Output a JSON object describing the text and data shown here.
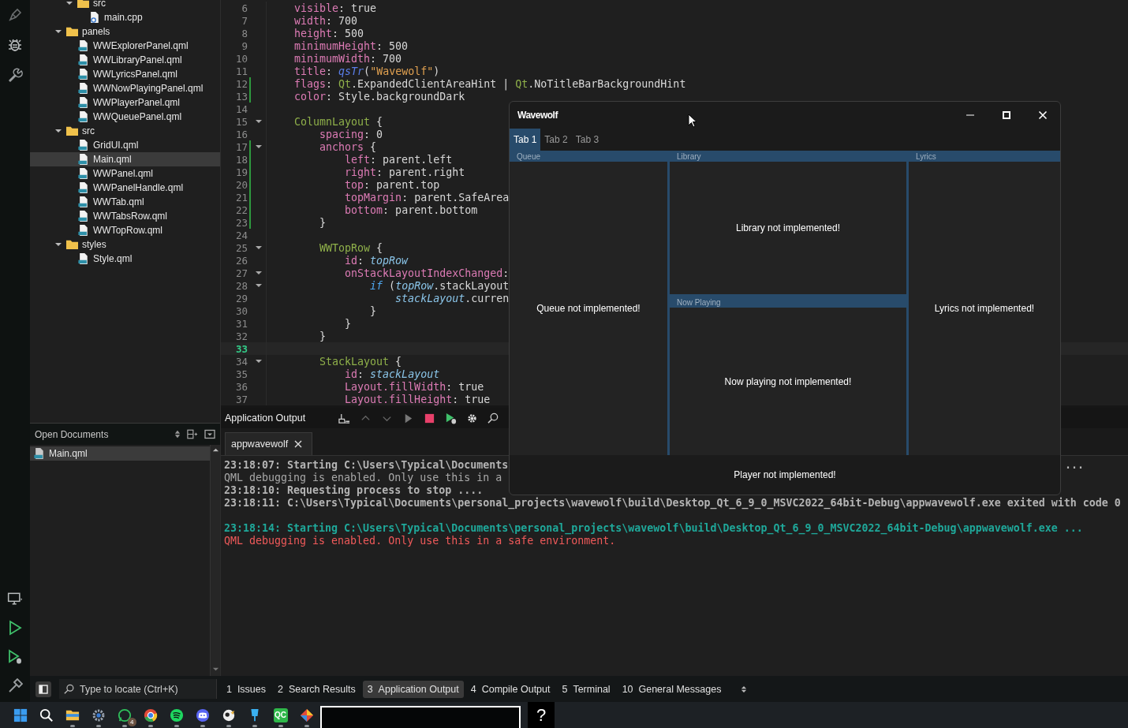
{
  "tree_top": [
    {
      "label": "src",
      "kind": "folder",
      "expanded": true,
      "selected": false,
      "children": [
        {
          "label": "main.cpp",
          "kind": "cpp",
          "selected": false
        }
      ]
    }
  ],
  "tree": [
    {
      "label": "panels",
      "kind": "folder",
      "expanded": true,
      "selected": false,
      "children": [
        {
          "label": "WWExplorerPanel.qml",
          "kind": "qml",
          "selected": false
        },
        {
          "label": "WWLibraryPanel.qml",
          "kind": "qml",
          "selected": false
        },
        {
          "label": "WWLyricsPanel.qml",
          "kind": "qml",
          "selected": false
        },
        {
          "label": "WWNowPlayingPanel.qml",
          "kind": "qml",
          "selected": false
        },
        {
          "label": "WWPlayerPanel.qml",
          "kind": "qml",
          "selected": false
        },
        {
          "label": "WWQueuePanel.qml",
          "kind": "qml",
          "selected": false
        }
      ]
    },
    {
      "label": "src",
      "kind": "folder",
      "expanded": true,
      "selected": false,
      "children": [
        {
          "label": "GridUI.qml",
          "kind": "qml",
          "selected": false
        },
        {
          "label": "Main.qml",
          "kind": "qml",
          "selected": true
        },
        {
          "label": "WWPanel.qml",
          "kind": "qml",
          "selected": false
        },
        {
          "label": "WWPanelHandle.qml",
          "kind": "qml",
          "selected": false
        },
        {
          "label": "WWTab.qml",
          "kind": "qml",
          "selected": false
        },
        {
          "label": "WWTabsRow.qml",
          "kind": "qml",
          "selected": false
        },
        {
          "label": "WWTopRow.qml",
          "kind": "qml",
          "selected": false
        }
      ]
    },
    {
      "label": "styles",
      "kind": "folder",
      "expanded": true,
      "selected": false,
      "children": [
        {
          "label": "Style.qml",
          "kind": "qml",
          "selected": false
        }
      ]
    }
  ],
  "open_documents": {
    "title": "Open Documents",
    "items": [
      {
        "label": "Main.qml",
        "selected": true
      }
    ]
  },
  "editor": {
    "lines": [
      {
        "n": "6",
        "changed": false,
        "foldable": false,
        "current": false,
        "tokens": [
          {
            "kind": "p",
            "t": "    visible"
          },
          {
            "kind": "t",
            "t": ": true"
          }
        ]
      },
      {
        "n": "7",
        "changed": false,
        "foldable": false,
        "current": false,
        "tokens": [
          {
            "kind": "p",
            "t": "    width"
          },
          {
            "kind": "t",
            "t": ": 700"
          }
        ]
      },
      {
        "n": "8",
        "changed": false,
        "foldable": false,
        "current": false,
        "tokens": [
          {
            "kind": "p",
            "t": "    height"
          },
          {
            "kind": "t",
            "t": ": 500"
          }
        ]
      },
      {
        "n": "9",
        "changed": false,
        "foldable": false,
        "current": false,
        "tokens": [
          {
            "kind": "p",
            "t": "    minimumHeight"
          },
          {
            "kind": "t",
            "t": ": 500"
          }
        ]
      },
      {
        "n": "10",
        "changed": false,
        "foldable": false,
        "current": false,
        "tokens": [
          {
            "kind": "p",
            "t": "    minimumWidth"
          },
          {
            "kind": "t",
            "t": ": 700"
          }
        ]
      },
      {
        "n": "11",
        "changed": false,
        "foldable": false,
        "current": false,
        "tokens": [
          {
            "kind": "p",
            "t": "    title"
          },
          {
            "kind": "t",
            "t": ": "
          },
          {
            "kind": "fn",
            "t": "qsTr"
          },
          {
            "kind": "t",
            "t": "("
          },
          {
            "kind": "s",
            "t": "\"Wavewolf\""
          },
          {
            "kind": "t",
            "t": ")"
          }
        ]
      },
      {
        "n": "12",
        "changed": true,
        "foldable": false,
        "current": false,
        "tokens": [
          {
            "kind": "p",
            "t": "    flags"
          },
          {
            "kind": "t",
            "t": ": "
          },
          {
            "kind": "ty",
            "t": "Qt"
          },
          {
            "kind": "t",
            "t": ".ExpandedClientAreaHint | "
          },
          {
            "kind": "ty",
            "t": "Qt"
          },
          {
            "kind": "t",
            "t": ".NoTitleBarBackgroundHint"
          }
        ]
      },
      {
        "n": "13",
        "changed": true,
        "foldable": false,
        "current": false,
        "tokens": [
          {
            "kind": "p",
            "t": "    color"
          },
          {
            "kind": "t",
            "t": ": Style.backgroundDark"
          }
        ]
      },
      {
        "n": "14",
        "changed": false,
        "foldable": false,
        "current": false
      },
      {
        "n": "15",
        "changed": false,
        "foldable": true,
        "current": false,
        "tokens": [
          {
            "kind": "ty",
            "t": "    ColumnLayout"
          },
          {
            "kind": "t",
            "t": " {"
          }
        ]
      },
      {
        "n": "16",
        "changed": false,
        "foldable": false,
        "current": false,
        "tokens": [
          {
            "kind": "p",
            "t": "        spacing"
          },
          {
            "kind": "t",
            "t": ": 0"
          }
        ]
      },
      {
        "n": "17",
        "changed": true,
        "foldable": true,
        "current": false,
        "tokens": [
          {
            "kind": "p",
            "t": "        anchors"
          },
          {
            "kind": "t",
            "t": " {"
          }
        ]
      },
      {
        "n": "18",
        "changed": true,
        "foldable": false,
        "current": false,
        "tokens": [
          {
            "kind": "p",
            "t": "            left"
          },
          {
            "kind": "t",
            "t": ": parent.left"
          }
        ]
      },
      {
        "n": "19",
        "changed": true,
        "foldable": false,
        "current": false,
        "tokens": [
          {
            "kind": "p",
            "t": "            right"
          },
          {
            "kind": "t",
            "t": ": parent.right"
          }
        ]
      },
      {
        "n": "20",
        "changed": true,
        "foldable": false,
        "current": false,
        "tokens": [
          {
            "kind": "p",
            "t": "            top"
          },
          {
            "kind": "t",
            "t": ": parent.top"
          }
        ]
      },
      {
        "n": "21",
        "changed": true,
        "foldable": false,
        "current": false,
        "tokens": [
          {
            "kind": "p",
            "t": "            topMargin"
          },
          {
            "kind": "t",
            "t": ": parent.SafeArea"
          }
        ]
      },
      {
        "n": "22",
        "changed": true,
        "foldable": false,
        "current": false,
        "tokens": [
          {
            "kind": "p",
            "t": "            bottom"
          },
          {
            "kind": "t",
            "t": ": parent.bottom"
          }
        ]
      },
      {
        "n": "23",
        "changed": true,
        "foldable": false,
        "current": false,
        "tokens": [
          {
            "kind": "t",
            "t": "        }"
          }
        ]
      },
      {
        "n": "24",
        "changed": false,
        "foldable": false,
        "current": false
      },
      {
        "n": "25",
        "changed": false,
        "foldable": true,
        "current": false,
        "tokens": [
          {
            "kind": "ty",
            "t": "        WWTopRow"
          },
          {
            "kind": "t",
            "t": " {"
          }
        ]
      },
      {
        "n": "26",
        "changed": false,
        "foldable": false,
        "current": false,
        "tokens": [
          {
            "kind": "p",
            "t": "            id"
          },
          {
            "kind": "t",
            "t": ": "
          },
          {
            "kind": "id",
            "t": "topRow"
          }
        ]
      },
      {
        "n": "27",
        "changed": false,
        "foldable": true,
        "current": false,
        "tokens": [
          {
            "kind": "p",
            "t": "            onStackLayoutIndexChanged"
          },
          {
            "kind": "t",
            "t": ":"
          }
        ]
      },
      {
        "n": "28",
        "changed": false,
        "foldable": true,
        "current": false,
        "tokens": [
          {
            "kind": "kw",
            "t": "                if"
          },
          {
            "kind": "t",
            "t": " ("
          },
          {
            "kind": "id",
            "t": "topRow"
          },
          {
            "kind": "t",
            "t": ".stackLayout"
          }
        ]
      },
      {
        "n": "29",
        "changed": false,
        "foldable": false,
        "current": false,
        "tokens": [
          {
            "kind": "id",
            "t": "                    stackLayout"
          },
          {
            "kind": "t",
            "t": ".curren"
          }
        ]
      },
      {
        "n": "30",
        "changed": false,
        "foldable": false,
        "current": false,
        "tokens": [
          {
            "kind": "t",
            "t": "                }"
          }
        ]
      },
      {
        "n": "31",
        "changed": false,
        "foldable": false,
        "current": false,
        "tokens": [
          {
            "kind": "t",
            "t": "            }"
          }
        ]
      },
      {
        "n": "32",
        "changed": false,
        "foldable": false,
        "current": false,
        "tokens": [
          {
            "kind": "t",
            "t": "        }"
          }
        ]
      },
      {
        "n": "33",
        "changed": false,
        "foldable": false,
        "current": true
      },
      {
        "n": "34",
        "changed": false,
        "foldable": true,
        "current": false,
        "tokens": [
          {
            "kind": "ty",
            "t": "        StackLayout"
          },
          {
            "kind": "t",
            "t": " {"
          }
        ]
      },
      {
        "n": "35",
        "changed": false,
        "foldable": false,
        "current": false,
        "tokens": [
          {
            "kind": "p",
            "t": "            id"
          },
          {
            "kind": "t",
            "t": ": "
          },
          {
            "kind": "id",
            "t": "stackLayout"
          }
        ]
      },
      {
        "n": "36",
        "changed": false,
        "foldable": false,
        "current": false,
        "tokens": [
          {
            "kind": "p",
            "t": "            Layout.fillWidth"
          },
          {
            "kind": "t",
            "t": ": true"
          }
        ]
      },
      {
        "n": "37",
        "changed": false,
        "foldable": false,
        "current": false,
        "tokens": [
          {
            "kind": "p",
            "t": "            Layout.fillHeight"
          },
          {
            "kind": "t",
            "t": ": true"
          }
        ]
      }
    ]
  },
  "output": {
    "title": "Application Output",
    "tab": "appwavewolf",
    "lines": [
      {
        "kind": "info",
        "text": "23:18:07: Starting C:\\Users\\Typical\\Documents",
        "tail": "..."
      },
      {
        "kind": "plain",
        "text": "QML debugging is enabled. Only use this in a"
      },
      {
        "kind": "info",
        "text": "23:18:10: Requesting process to stop ...."
      },
      {
        "kind": "info",
        "text": "23:18:11: C:\\Users\\Typical\\Documents\\personal_projects\\wavewolf\\build\\Desktop_Qt_6_9_0_MSVC2022_64bit-Debug\\appwavewolf.exe exited with code 0"
      },
      {
        "kind": "blank"
      },
      {
        "kind": "start",
        "text": "23:18:14: Starting C:\\Users\\Typical\\Documents\\personal_projects\\wavewolf\\build\\Desktop_Qt_6_9_0_MSVC2022_64bit-Debug\\appwavewolf.exe ..."
      },
      {
        "kind": "error",
        "text": "QML debugging is enabled. Only use this in a safe environment."
      }
    ]
  },
  "app_window": {
    "title": "Wavewolf",
    "tabs": [
      {
        "label": "Tab 1",
        "selected": true
      },
      {
        "label": "Tab 2",
        "selected": false
      },
      {
        "label": "Tab 3",
        "selected": false
      }
    ],
    "columns": [
      {
        "panels": [
          {
            "header": "Queue",
            "message": "Queue not implemented!"
          }
        ]
      },
      {
        "panels": [
          {
            "header": "Library",
            "message": "Library not implemented!"
          },
          {
            "header": "Now Playing",
            "message": "Now playing not implemented!"
          }
        ]
      },
      {
        "panels": [
          {
            "header": "Lyrics",
            "message": "Lyrics not implemented!"
          }
        ]
      }
    ],
    "player_message": "Player not implemented!"
  },
  "status_bar": {
    "locator": {
      "placeholder": "Type to locate (Ctrl+K)"
    },
    "tabs": [
      {
        "number": "1",
        "label": "Issues",
        "selected": false
      },
      {
        "number": "2",
        "label": "Search Results",
        "selected": false
      },
      {
        "number": "3",
        "label": "Application Output",
        "selected": true
      },
      {
        "number": "4",
        "label": "Compile Output",
        "selected": false
      },
      {
        "number": "5",
        "label": "Terminal",
        "selected": false
      },
      {
        "number": "10",
        "label": "General Messages",
        "selected": false
      }
    ]
  },
  "taskbar": {
    "items": [
      {
        "kind": "start",
        "running": false
      },
      {
        "kind": "search",
        "running": false
      },
      {
        "kind": "files",
        "running": true
      },
      {
        "kind": "settings",
        "running": true
      },
      {
        "kind": "chat",
        "running": true,
        "badge": "4"
      },
      {
        "kind": "browser",
        "running": true
      },
      {
        "kind": "music",
        "running": true
      },
      {
        "kind": "voice",
        "running": true
      },
      {
        "kind": "bird",
        "running": true
      },
      {
        "kind": "pin",
        "running": true
      },
      {
        "kind": "tile",
        "running": true,
        "label": "QC"
      },
      {
        "kind": "diamond",
        "running": true
      }
    ],
    "help_label": "?"
  }
}
